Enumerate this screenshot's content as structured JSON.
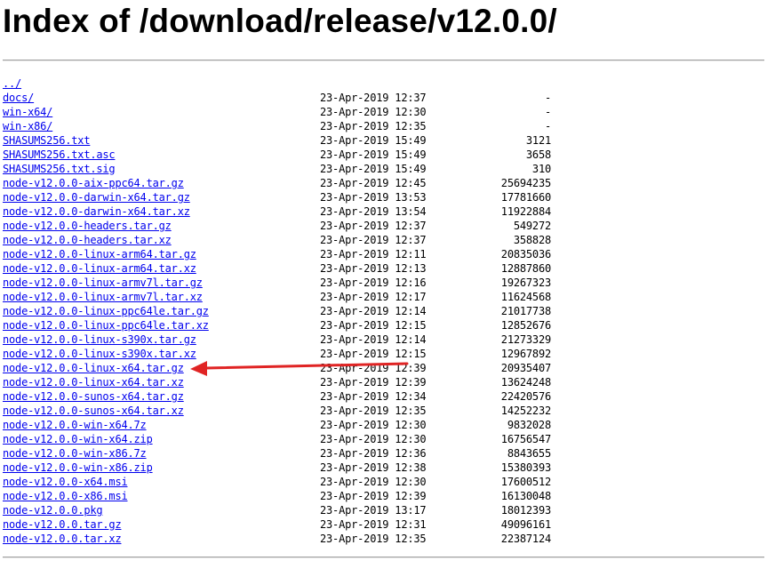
{
  "page": {
    "title": "Index of /download/release/v12.0.0/"
  },
  "annotation": {
    "arrow_color": "#e02424"
  },
  "rows": [
    {
      "name": "../",
      "date": "",
      "size": ""
    },
    {
      "name": "docs/",
      "date": "23-Apr-2019 12:37",
      "size": "-"
    },
    {
      "name": "win-x64/",
      "date": "23-Apr-2019 12:30",
      "size": "-"
    },
    {
      "name": "win-x86/",
      "date": "23-Apr-2019 12:35",
      "size": "-"
    },
    {
      "name": "SHASUMS256.txt",
      "date": "23-Apr-2019 15:49",
      "size": "3121"
    },
    {
      "name": "SHASUMS256.txt.asc",
      "date": "23-Apr-2019 15:49",
      "size": "3658"
    },
    {
      "name": "SHASUMS256.txt.sig",
      "date": "23-Apr-2019 15:49",
      "size": "310"
    },
    {
      "name": "node-v12.0.0-aix-ppc64.tar.gz",
      "date": "23-Apr-2019 12:45",
      "size": "25694235"
    },
    {
      "name": "node-v12.0.0-darwin-x64.tar.gz",
      "date": "23-Apr-2019 13:53",
      "size": "17781660"
    },
    {
      "name": "node-v12.0.0-darwin-x64.tar.xz",
      "date": "23-Apr-2019 13:54",
      "size": "11922884"
    },
    {
      "name": "node-v12.0.0-headers.tar.gz",
      "date": "23-Apr-2019 12:37",
      "size": "549272"
    },
    {
      "name": "node-v12.0.0-headers.tar.xz",
      "date": "23-Apr-2019 12:37",
      "size": "358828"
    },
    {
      "name": "node-v12.0.0-linux-arm64.tar.gz",
      "date": "23-Apr-2019 12:11",
      "size": "20835036"
    },
    {
      "name": "node-v12.0.0-linux-arm64.tar.xz",
      "date": "23-Apr-2019 12:13",
      "size": "12887860"
    },
    {
      "name": "node-v12.0.0-linux-armv7l.tar.gz",
      "date": "23-Apr-2019 12:16",
      "size": "19267323"
    },
    {
      "name": "node-v12.0.0-linux-armv7l.tar.xz",
      "date": "23-Apr-2019 12:17",
      "size": "11624568"
    },
    {
      "name": "node-v12.0.0-linux-ppc64le.tar.gz",
      "date": "23-Apr-2019 12:14",
      "size": "21017738"
    },
    {
      "name": "node-v12.0.0-linux-ppc64le.tar.xz",
      "date": "23-Apr-2019 12:15",
      "size": "12852676"
    },
    {
      "name": "node-v12.0.0-linux-s390x.tar.gz",
      "date": "23-Apr-2019 12:14",
      "size": "21273329"
    },
    {
      "name": "node-v12.0.0-linux-s390x.tar.xz",
      "date": "23-Apr-2019 12:15",
      "size": "12967892"
    },
    {
      "name": "node-v12.0.0-linux-x64.tar.gz",
      "date": "23-Apr-2019 12:39",
      "size": "20935407"
    },
    {
      "name": "node-v12.0.0-linux-x64.tar.xz",
      "date": "23-Apr-2019 12:39",
      "size": "13624248"
    },
    {
      "name": "node-v12.0.0-sunos-x64.tar.gz",
      "date": "23-Apr-2019 12:34",
      "size": "22420576"
    },
    {
      "name": "node-v12.0.0-sunos-x64.tar.xz",
      "date": "23-Apr-2019 12:35",
      "size": "14252232"
    },
    {
      "name": "node-v12.0.0-win-x64.7z",
      "date": "23-Apr-2019 12:30",
      "size": "9832028"
    },
    {
      "name": "node-v12.0.0-win-x64.zip",
      "date": "23-Apr-2019 12:30",
      "size": "16756547"
    },
    {
      "name": "node-v12.0.0-win-x86.7z",
      "date": "23-Apr-2019 12:36",
      "size": "8843655"
    },
    {
      "name": "node-v12.0.0-win-x86.zip",
      "date": "23-Apr-2019 12:38",
      "size": "15380393"
    },
    {
      "name": "node-v12.0.0-x64.msi",
      "date": "23-Apr-2019 12:30",
      "size": "17600512"
    },
    {
      "name": "node-v12.0.0-x86.msi",
      "date": "23-Apr-2019 12:39",
      "size": "16130048"
    },
    {
      "name": "node-v12.0.0.pkg",
      "date": "23-Apr-2019 13:17",
      "size": "18012393"
    },
    {
      "name": "node-v12.0.0.tar.gz",
      "date": "23-Apr-2019 12:31",
      "size": "49096161"
    },
    {
      "name": "node-v12.0.0.tar.xz",
      "date": "23-Apr-2019 12:35",
      "size": "22387124"
    }
  ]
}
